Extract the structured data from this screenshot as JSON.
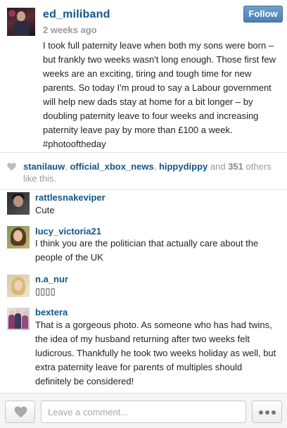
{
  "post": {
    "username": "ed_miliband",
    "time_ago": "2 weeks ago",
    "follow_label": "Follow",
    "caption": "I took full paternity leave when both my sons were born – but frankly two weeks wasn't long enough. Those first few weeks are an exciting, tiring and tough time for new parents. So today I'm proud to say a Labour government will help new dads stay at home for a bit longer – by doubling paternity leave to four weeks and increasing paternity leave pay by more than £100 a week. #photooftheday"
  },
  "likes": {
    "user1": "stanilauw",
    "sep1": ", ",
    "user2": "official_xbox_news",
    "sep2": ", ",
    "user3": "hippydippy",
    "and_text": " and ",
    "count": "351",
    "suffix": " others like this."
  },
  "comments": [
    {
      "username": "rattlesnakeviper",
      "text": "Cute"
    },
    {
      "username": "lucy_victoria21",
      "text": "I think you are the politician that actually care about the people of the UK"
    },
    {
      "username": "n.a_nur",
      "text": "▯▯▯▯"
    },
    {
      "username": "bextera",
      "text": "That is a gorgeous photo. As someone who has had twins, the idea of my husband returning after two weeks felt ludicrous. Thankfully he took two weeks holiday as well, but extra paternity leave for parents of multiples should definitely be considered!"
    }
  ],
  "bottom": {
    "comment_placeholder": "Leave a comment..."
  },
  "icons": {
    "like_button": "heart-icon",
    "likes_indicator": "heart-icon",
    "more_button": "ellipsis-icon"
  },
  "colors": {
    "username": "#125688",
    "follow_button": "#5b8fbf",
    "muted": "#999999"
  }
}
